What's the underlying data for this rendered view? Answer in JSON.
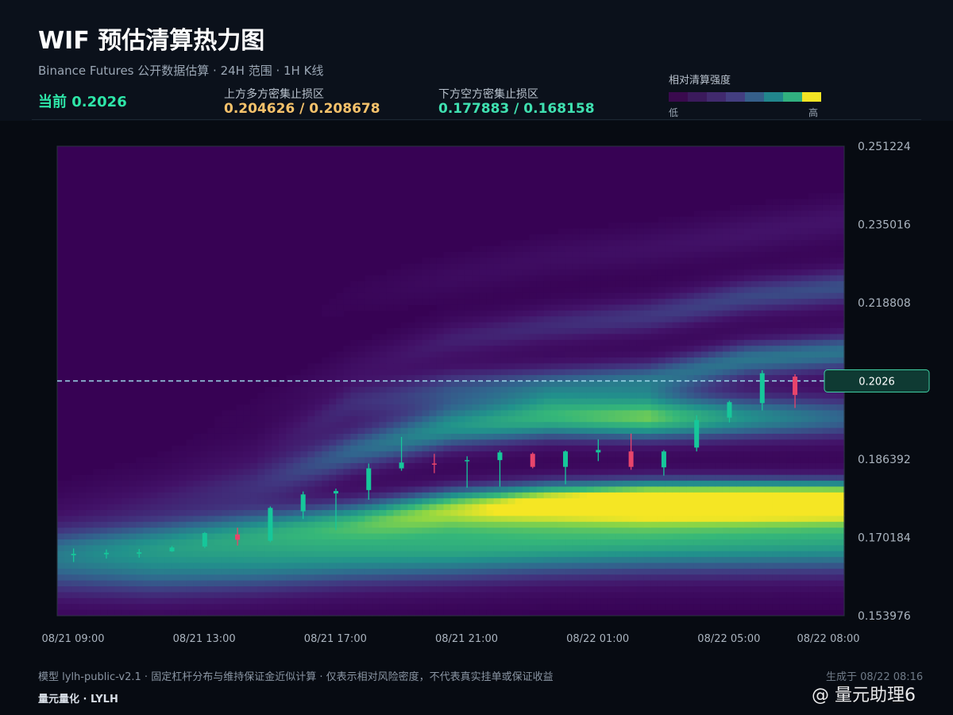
{
  "header": {
    "title": "WIF 预估清算热力图",
    "subtitle": "Binance Futures 公开数据估算 · 24H 范围 · 1H K线",
    "current_label": "当前 0.2026",
    "upper_zone_label": "上方多方密集止损区",
    "upper_zone_values": "0.204626 / 0.208678",
    "lower_zone_label": "下方空方密集止损区",
    "lower_zone_values": "0.177883 / 0.168158",
    "legend_title": "相对清算强度",
    "legend_low": "低",
    "legend_high": "高"
  },
  "colors": {
    "accent_green": "#2ee6a8",
    "upper_zone": "#f5c26b",
    "lower_zone": "#3fe0b0",
    "bull_candle": "#16c79a",
    "bear_candle": "#e8456b",
    "price_line": "#9fdcec",
    "legend_scale": [
      "#3a0a4e",
      "#3b1a5c",
      "#412a6e",
      "#433e80",
      "#355f8a",
      "#21868d",
      "#31b07f",
      "#f3e524"
    ]
  },
  "chart_data": {
    "type": "heatmap",
    "title": "",
    "xlabel": "",
    "ylabel": "",
    "x_ticks": [
      "08/21 09:00",
      "08/21 13:00",
      "08/21 17:00",
      "08/21 21:00",
      "08/22 01:00",
      "08/22 05:00",
      "08/22 08:00"
    ],
    "y_ticks": [
      "0.251224",
      "0.235016",
      "0.218808",
      "0.202600",
      "0.186392",
      "0.170184",
      "0.153976"
    ],
    "y_tick_labels": [
      "0.251224",
      "0.235016",
      "0.218808",
      "0.186392",
      "0.170184",
      "0.153976"
    ],
    "ylim": [
      0.153976,
      0.251224
    ],
    "x_range_hours": [
      0,
      24
    ],
    "current_price": 0.2026,
    "current_price_label": "0.2026",
    "heat_bands": [
      {
        "center": [
          0.165,
          0.165,
          0.166,
          0.1675,
          0.1685,
          0.1695,
          0.17,
          0.17,
          0.17
        ],
        "width": 0.0055,
        "intensity": [
          0.45,
          0.55,
          0.6,
          0.65,
          0.7,
          0.72,
          0.72,
          0.7,
          0.68
        ]
      },
      {
        "center": [
          0.168,
          0.17,
          0.172,
          0.174,
          0.1765,
          0.1775,
          0.1778,
          0.1778,
          0.1778
        ],
        "width": 0.003,
        "intensity": [
          0.1,
          0.2,
          0.3,
          0.4,
          0.65,
          0.85,
          0.98,
          1.0,
          0.98
        ]
      },
      {
        "center": [
          0.176,
          0.178,
          0.181,
          0.188,
          0.193,
          0.195,
          0.195,
          0.195,
          0.195
        ],
        "width": 0.0035,
        "intensity": [
          0.05,
          0.15,
          0.25,
          0.45,
          0.6,
          0.72,
          0.82,
          0.6,
          0.45
        ]
      },
      {
        "center": [
          0.182,
          0.185,
          0.188,
          0.198,
          0.201,
          0.202,
          0.203,
          0.207,
          0.2085
        ],
        "width": 0.003,
        "intensity": [
          0.0,
          0.02,
          0.08,
          0.25,
          0.35,
          0.4,
          0.45,
          0.5,
          0.5
        ]
      },
      {
        "center": [
          0.19,
          0.193,
          0.196,
          0.205,
          0.211,
          0.214,
          0.216,
          0.22,
          0.222
        ],
        "width": 0.003,
        "intensity": [
          0.0,
          0.0,
          0.03,
          0.1,
          0.2,
          0.25,
          0.3,
          0.35,
          0.38
        ]
      },
      {
        "center": [
          0.2,
          0.205,
          0.21,
          0.22,
          0.224,
          0.228,
          0.23,
          0.233,
          0.236
        ],
        "width": 0.003,
        "intensity": [
          0.0,
          0.0,
          0.0,
          0.03,
          0.08,
          0.1,
          0.12,
          0.15,
          0.15
        ]
      }
    ],
    "candles": [
      {
        "h": 0,
        "o": 0.1665,
        "c": 0.1668,
        "l": 0.1651,
        "hi": 0.1679
      },
      {
        "h": 1,
        "o": 0.1667,
        "c": 0.167,
        "l": 0.1658,
        "hi": 0.1677
      },
      {
        "h": 2,
        "o": 0.1668,
        "c": 0.1671,
        "l": 0.166,
        "hi": 0.1678
      },
      {
        "h": 3,
        "o": 0.1673,
        "c": 0.1681,
        "l": 0.1672,
        "hi": 0.1684
      },
      {
        "h": 4,
        "o": 0.1683,
        "c": 0.1711,
        "l": 0.168,
        "hi": 0.1713
      },
      {
        "h": 5,
        "o": 0.1708,
        "c": 0.1697,
        "l": 0.1685,
        "hi": 0.1722
      },
      {
        "h": 6,
        "o": 0.1695,
        "c": 0.1763,
        "l": 0.1692,
        "hi": 0.1766
      },
      {
        "h": 7,
        "o": 0.1756,
        "c": 0.1791,
        "l": 0.174,
        "hi": 0.1797
      },
      {
        "h": 8,
        "o": 0.1793,
        "c": 0.1798,
        "l": 0.1717,
        "hi": 0.1803
      },
      {
        "h": 9,
        "o": 0.18,
        "c": 0.1845,
        "l": 0.178,
        "hi": 0.1855
      },
      {
        "h": 10,
        "o": 0.1845,
        "c": 0.1857,
        "l": 0.184,
        "hi": 0.191
      },
      {
        "h": 11,
        "o": 0.1855,
        "c": 0.1853,
        "l": 0.1835,
        "hi": 0.1875
      },
      {
        "h": 12,
        "o": 0.186,
        "c": 0.1862,
        "l": 0.1805,
        "hi": 0.187
      },
      {
        "h": 13,
        "o": 0.1862,
        "c": 0.1878,
        "l": 0.1807,
        "hi": 0.1882
      },
      {
        "h": 14,
        "o": 0.1875,
        "c": 0.1848,
        "l": 0.1845,
        "hi": 0.1878
      },
      {
        "h": 15,
        "o": 0.1848,
        "c": 0.188,
        "l": 0.1812,
        "hi": 0.1882
      },
      {
        "h": 16,
        "o": 0.1878,
        "c": 0.1883,
        "l": 0.186,
        "hi": 0.1905
      },
      {
        "h": 17,
        "o": 0.188,
        "c": 0.1848,
        "l": 0.1842,
        "hi": 0.1917
      },
      {
        "h": 18,
        "o": 0.1847,
        "c": 0.188,
        "l": 0.183,
        "hi": 0.1883
      },
      {
        "h": 19,
        "o": 0.1888,
        "c": 0.1945,
        "l": 0.188,
        "hi": 0.1955
      },
      {
        "h": 20,
        "o": 0.195,
        "c": 0.1982,
        "l": 0.194,
        "hi": 0.1985
      },
      {
        "h": 21,
        "o": 0.198,
        "c": 0.2042,
        "l": 0.1965,
        "hi": 0.2048
      },
      {
        "h": 22,
        "o": 0.2035,
        "c": 0.1997,
        "l": 0.197,
        "hi": 0.204
      },
      {
        "h": 23,
        "o": 0.201,
        "c": 0.2026,
        "l": 0.2005,
        "hi": 0.203
      }
    ]
  },
  "footer": {
    "note": "模型 lylh-public-v2.1 · 固定杠杆分布与维持保证金近似计算 · 仅表示相对风险密度，不代表真实挂单或保证收益",
    "brand": "量元量化 · LYLH",
    "generated": "生成于 08/22 08:16",
    "watermark": "@ 量元助理6"
  }
}
